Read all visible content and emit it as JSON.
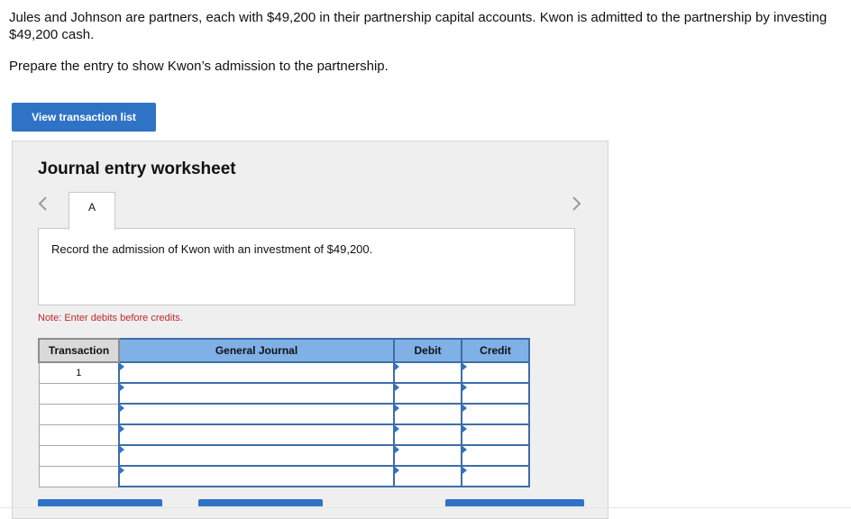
{
  "problem": {
    "text": "Jules and Johnson are partners, each with $49,200 in their partnership capital accounts. Kwon is admitted to the partnership by investing $49,200 cash.",
    "instruction": "Prepare the entry to show Kwon’s admission to the partnership."
  },
  "view_button": "View transaction list",
  "worksheet": {
    "title": "Journal entry worksheet",
    "tab_label": "A",
    "description": "Record the admission of Kwon with an investment of $49,200.",
    "note": "Note: Enter debits before credits."
  },
  "journal": {
    "headers": {
      "transaction": "Transaction",
      "general_journal": "General Journal",
      "debit": "Debit",
      "credit": "Credit"
    },
    "rows": [
      {
        "transaction": "1",
        "account": "",
        "debit": "",
        "credit": ""
      },
      {
        "transaction": "",
        "account": "",
        "debit": "",
        "credit": ""
      },
      {
        "transaction": "",
        "account": "",
        "debit": "",
        "credit": ""
      },
      {
        "transaction": "",
        "account": "",
        "debit": "",
        "credit": ""
      },
      {
        "transaction": "",
        "account": "",
        "debit": "",
        "credit": ""
      },
      {
        "transaction": "",
        "account": "",
        "debit": "",
        "credit": ""
      }
    ]
  },
  "colors": {
    "accent": "#2f73c6",
    "header_blue": "#7fb0e6",
    "note_red": "#c0282d"
  }
}
